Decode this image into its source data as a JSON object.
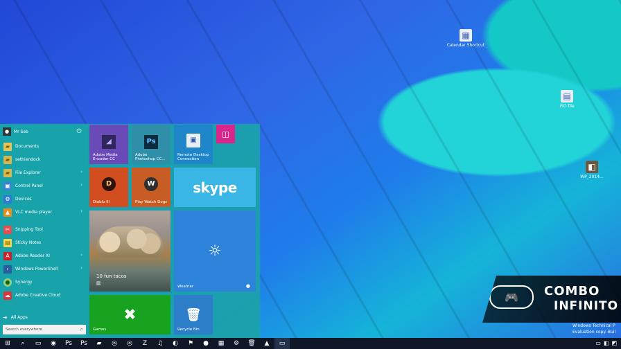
{
  "desktop": {
    "icons": [
      {
        "label": "Calendar Shortcut",
        "icon": "calendar-icon"
      },
      {
        "label": "ISO file",
        "icon": "document-icon"
      },
      {
        "label": "WP_2014...",
        "icon": "image-icon"
      }
    ]
  },
  "start_menu": {
    "user_name": "Mr Seb",
    "items": [
      {
        "label": "Documents",
        "icon": "folder-icon",
        "chevron": ""
      },
      {
        "label": "sethiendock",
        "icon": "folder-icon",
        "chevron": ""
      },
      {
        "label": "File Explorer",
        "icon": "folder-icon",
        "chevron": "›"
      },
      {
        "label": "Control Panel",
        "icon": "control-panel-icon",
        "chevron": "›"
      },
      {
        "label": "Devices",
        "icon": "gear-icon",
        "chevron": ""
      },
      {
        "label": "VLC media player",
        "icon": "vlc-icon",
        "chevron": "›"
      },
      {
        "label": "Snipping Tool",
        "icon": "scissors-icon",
        "chevron": ""
      },
      {
        "label": "Sticky Notes",
        "icon": "note-icon",
        "chevron": ""
      },
      {
        "label": "Adobe Reader XI",
        "icon": "pdf-icon",
        "chevron": "›"
      },
      {
        "label": "Windows PowerShell",
        "icon": "terminal-icon",
        "chevron": "›"
      },
      {
        "label": "Synergy",
        "icon": "sync-icon",
        "chevron": ""
      },
      {
        "label": "Adobe Creative Cloud",
        "icon": "creative-cloud-icon",
        "chevron": ""
      }
    ],
    "all_apps": "All Apps",
    "search_placeholder": "Search everywhere"
  },
  "tiles": {
    "media_encoder": "Adobe Media Encoder CC",
    "photoshop": "Adobe Photoshop CC...",
    "remote_desktop": "Remote Desktop Connection",
    "diablo": "Diablo III",
    "watch_dogs": "Play Watch Dogs",
    "skype": "skype",
    "food_title": "10 fun tacos",
    "weather": "Weather",
    "games": "Games",
    "recycle_bin": "Recycle Bin"
  },
  "watermark": {
    "line1": "COMBO",
    "line2": "INFINITO"
  },
  "system": {
    "line1": "Windows Technical P",
    "line2": "Evaluation copy. Buil"
  },
  "taskbar": {
    "items": [
      {
        "icon": "windows-icon",
        "active": false
      },
      {
        "icon": "search-icon",
        "active": false
      },
      {
        "icon": "file-explorer-icon",
        "active": false
      },
      {
        "icon": "chrome-icon",
        "active": false
      },
      {
        "icon": "photoshop-icon",
        "active": false
      },
      {
        "icon": "photoshop-icon",
        "active": false
      },
      {
        "icon": "folder-icon",
        "active": false
      },
      {
        "icon": "steam-icon",
        "active": false
      },
      {
        "icon": "steam-icon",
        "active": false
      },
      {
        "icon": "filezilla-icon",
        "active": false
      },
      {
        "icon": "spotify-icon",
        "active": false
      },
      {
        "icon": "firefox-icon",
        "active": false
      },
      {
        "icon": "network-icon",
        "active": false
      },
      {
        "icon": "app-icon",
        "active": false
      },
      {
        "icon": "grid-icon",
        "active": false
      },
      {
        "icon": "settings-icon",
        "active": false
      },
      {
        "icon": "recycle-icon",
        "active": false
      },
      {
        "icon": "vlc-icon",
        "active": false
      },
      {
        "icon": "window-icon",
        "active": true
      }
    ]
  }
}
